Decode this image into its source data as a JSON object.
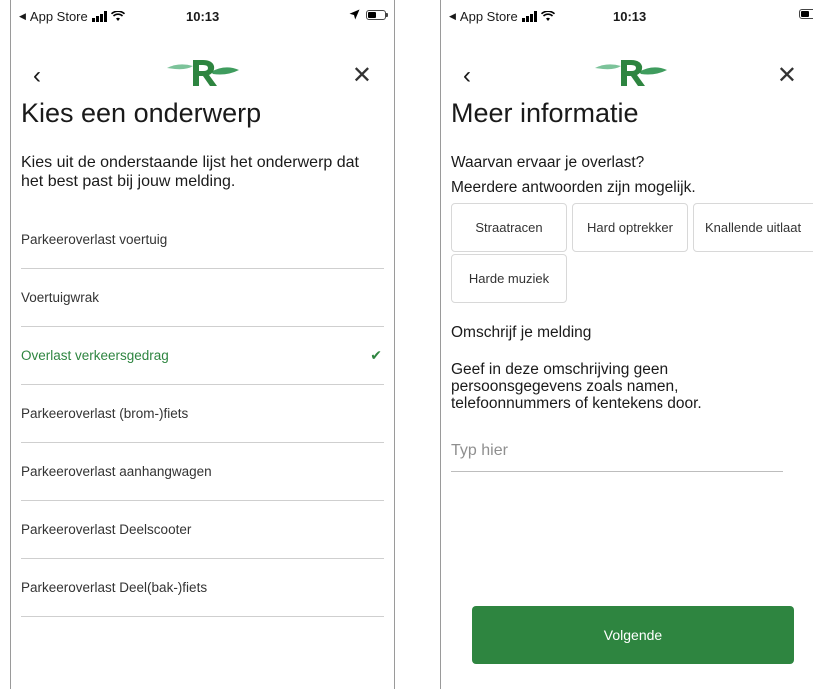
{
  "status_bar": {
    "carrier": "App Store",
    "time": "10:13"
  },
  "colors": {
    "accent": "#2e8540",
    "divider": "#cfcfcf"
  },
  "icons": {
    "back": "chevron-left-icon",
    "close": "close-icon",
    "check": "checkmark-icon",
    "logo": "rotterdam-logo"
  },
  "topic_screen": {
    "title": "Kies een onderwerp",
    "intro": "Kies uit de onderstaande lijst het onderwerp dat het best past bij jouw melding.",
    "items": [
      {
        "label": "Parkeeroverlast voertuig",
        "selected": false
      },
      {
        "label": "Voertuigwrak",
        "selected": false
      },
      {
        "label": "Overlast verkeersgedrag",
        "selected": true
      },
      {
        "label": "Parkeeroverlast (brom-)fiets",
        "selected": false
      },
      {
        "label": "Parkeeroverlast aanhangwagen",
        "selected": false
      },
      {
        "label": "Parkeeroverlast Deelscooter",
        "selected": false
      },
      {
        "label": "Parkeeroverlast Deel(bak-)fiets",
        "selected": false
      }
    ]
  },
  "info_screen": {
    "title": "Meer informatie",
    "question": "Waarvan ervaar je overlast?",
    "question_hint": "Meerdere antwoorden zijn mogelijk.",
    "options": [
      "Straatracen",
      "Hard optrekker",
      "Knallende uitlaat",
      "Harde muziek"
    ],
    "description_label": "Omschrijf je melding",
    "description_hint": "Geef in deze omschrijving geen persoonsgegevens zoals namen, telefoonnummers of kentekens door.",
    "input_placeholder": "Typ hier",
    "next_button": "Volgende"
  }
}
